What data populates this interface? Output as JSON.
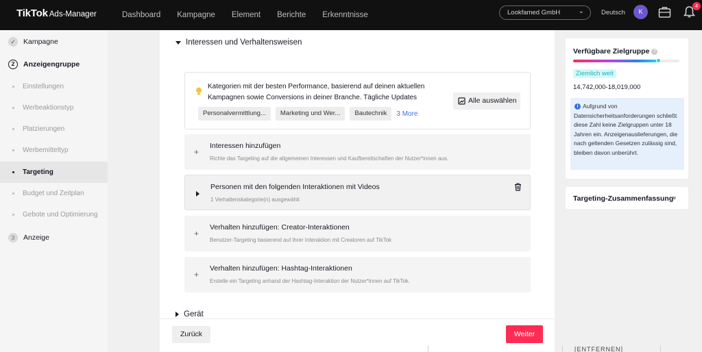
{
  "topbar": {
    "brand": "TikTok",
    "brand_sub": "Ads-Manager",
    "nav": [
      "Dashboard",
      "Kampagne",
      "Element",
      "Berichte",
      "Erkenntnisse"
    ],
    "account": "Lookfamed GmbH",
    "language": "Deutsch",
    "avatar_initial": "K",
    "notification_count": "4"
  },
  "sidebar": {
    "step1_num": "✓",
    "step1": "Kampagne",
    "step2_num": "2",
    "step2": "Anzeigengruppe",
    "sub": [
      "Einstellungen",
      "Werbeaktionstyp",
      "Platzierungen",
      "Werbemitteltyp",
      "Targeting",
      "Budget und Zeitplan",
      "Gebote und Optimierung"
    ],
    "active_sub": "Targeting",
    "step3_num": "3",
    "step3": "Anzeige"
  },
  "main": {
    "section_title": "Interessen und Verhaltensweisen",
    "recommendation_text": "Kategorien mit der besten Performance, basierend auf deinen aktuellen Kampagnen sowie Conversions in deiner Branche. Tägliche Updates",
    "tags": [
      "Personalvermittlung...",
      "Marketing und Wer...",
      "Bautechnik"
    ],
    "more_link": "3 More",
    "select_all": "Alle auswählen",
    "rows": [
      {
        "title": "Interessen hinzufügen",
        "desc": "Richte das Targeting auf die allgemeinen Interessen und Kaufbereitschaften der Nutzer*innen aus."
      },
      {
        "title": "Personen mit den folgenden Interaktionen mit Videos",
        "desc": "1 Verhaltenskategorie(n) ausgewählt"
      },
      {
        "title": "Verhalten hinzufügen: Creator-Interaktionen",
        "desc": "Benutzer-Targeting basierend auf ihrer Interaktion mit Creatoren auf TikTok"
      },
      {
        "title": "Verhalten hinzufügen: Hashtag-Interaktionen",
        "desc": "Erstelle ein Targeting anhand der Hashtag-Interaktion der Nutzer*innen auf TikTok."
      }
    ],
    "device_section": "Gerät",
    "back_button": "Zurück",
    "next_button": "Weiter"
  },
  "audience": {
    "title": "Verfügbare Zielgruppe",
    "help": "?",
    "level": "Ziemlich weit",
    "meter_fraction": 0.8,
    "size": "14,742,000-18,019,000",
    "info_icon": "i",
    "info_text": "Aufgrund von Datensicherheitsanforderungen schließt diese Zahl keine Zielgruppen unter 18 Jahren ein. Anzeigenauslieferungen, die nach geltenden Gesetzen zulässig sind, bleiben davon unberührt.",
    "summary_title": "Targeting-Zusammenfassung",
    "summary_icon": "»"
  },
  "background": {
    "cutoff_text": "[ENTFERNEN]"
  },
  "colors": {
    "topbar": "#111111",
    "primary": "#fe2c55",
    "link": "#3d73e0",
    "level_badge": "#12b7c2",
    "info_bg": "#e6effc"
  },
  "icons": [
    "check-icon",
    "bulb-icon",
    "select-all-icon",
    "plus-icon",
    "play-icon",
    "trash-icon",
    "bag-icon",
    "bell-icon",
    "help-icon",
    "info-icon",
    "chevron-down-icon",
    "double-chevron-down-icon"
  ]
}
